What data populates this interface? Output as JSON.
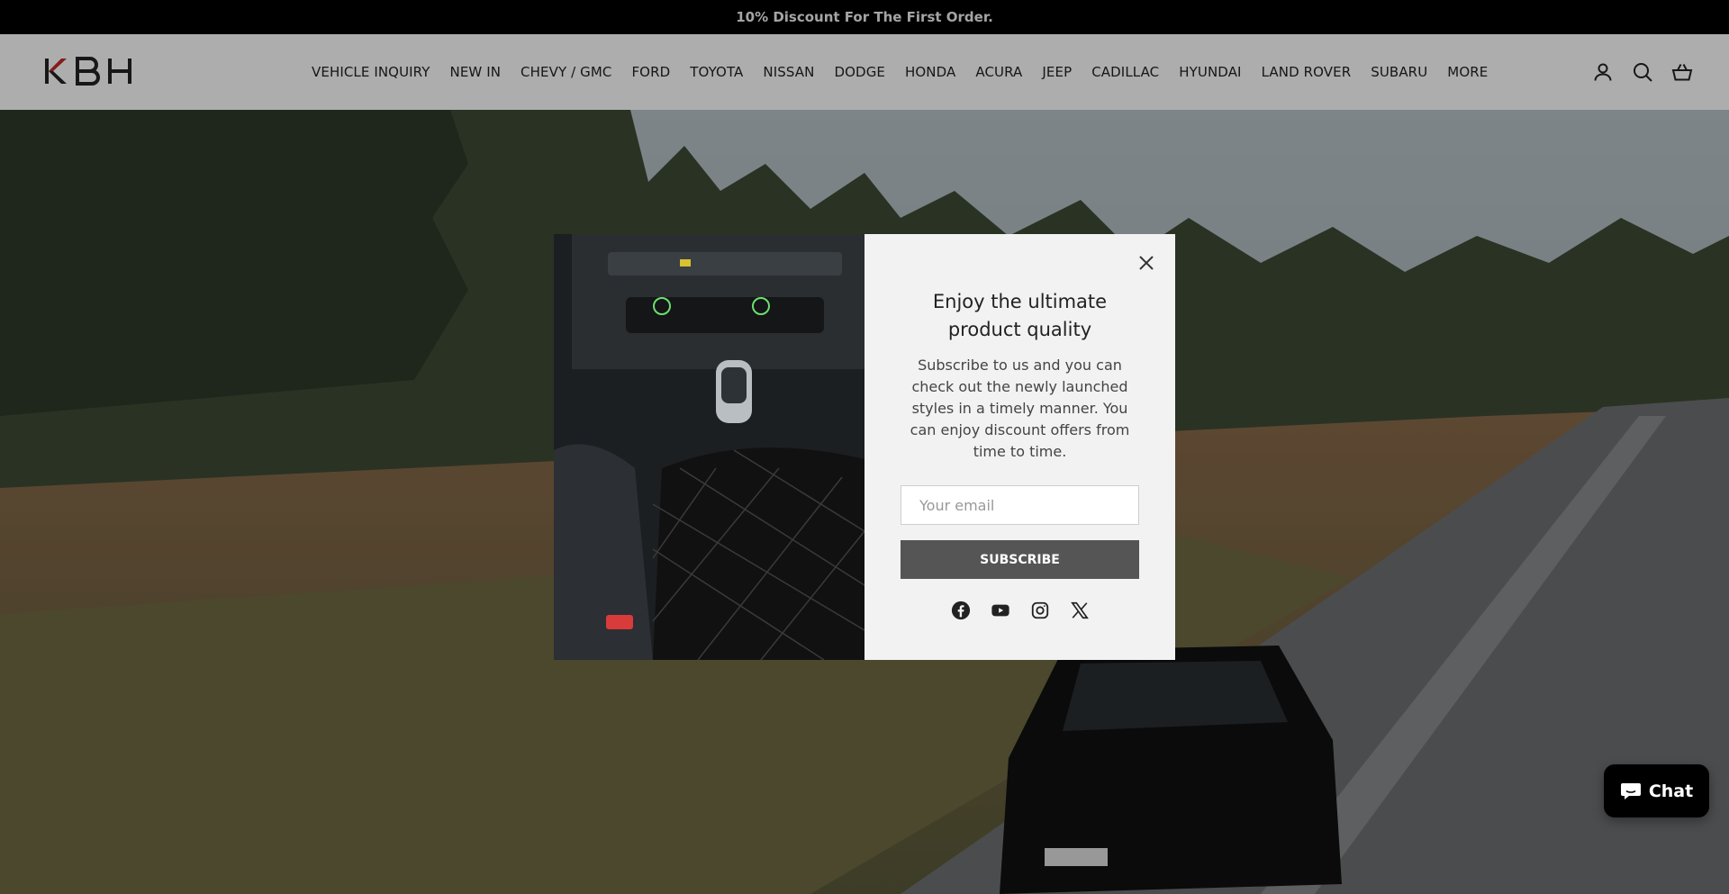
{
  "announcement": {
    "text": "10% Discount For The First Order."
  },
  "header": {
    "logo_text": "KBH",
    "nav": [
      "VEHICLE INQUIRY",
      "NEW IN",
      "CHEVY / GMC",
      "FORD",
      "TOYOTA",
      "NISSAN",
      "DODGE",
      "HONDA",
      "ACURA",
      "JEEP",
      "CADILLAC",
      "HYUNDAI",
      "LAND ROVER",
      "SUBARU",
      "MORE"
    ],
    "icons": [
      "account-icon",
      "search-icon",
      "cart-icon"
    ]
  },
  "popup": {
    "title": "Enjoy the ultimate product quality",
    "description": "Subscribe to us and you can check out the newly launched styles in a timely manner. You can enjoy discount offers from time to time.",
    "email_placeholder": "Your email",
    "email_value": "",
    "subscribe_label": "SUBSCRIBE",
    "socials": [
      "facebook-icon",
      "youtube-icon",
      "instagram-icon",
      "x-icon"
    ]
  },
  "chat": {
    "label": "Chat"
  },
  "colors": {
    "announcement_bg": "#000000",
    "button_bg": "#555555",
    "modal_bg": "#f2f2f2",
    "logo_accent": "#c62828"
  }
}
